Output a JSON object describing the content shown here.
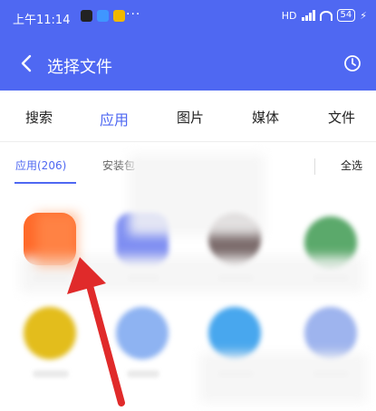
{
  "status_bar": {
    "time": "上午11:14",
    "more": "···",
    "hd": "HD",
    "battery": "54"
  },
  "header": {
    "title": "选择文件",
    "back_icon": "chevron-left-icon",
    "history_icon": "clock-icon"
  },
  "tabs": [
    {
      "label": "搜索"
    },
    {
      "label": "应用",
      "active": true
    },
    {
      "label": "图片"
    },
    {
      "label": "媒体"
    },
    {
      "label": "文件"
    }
  ],
  "subtabs": {
    "apps": "应用(206)",
    "installed": "安装包",
    "select_all": "全选"
  },
  "colors": {
    "brand": "#4f68f2",
    "arrow": "#e02a2a"
  }
}
